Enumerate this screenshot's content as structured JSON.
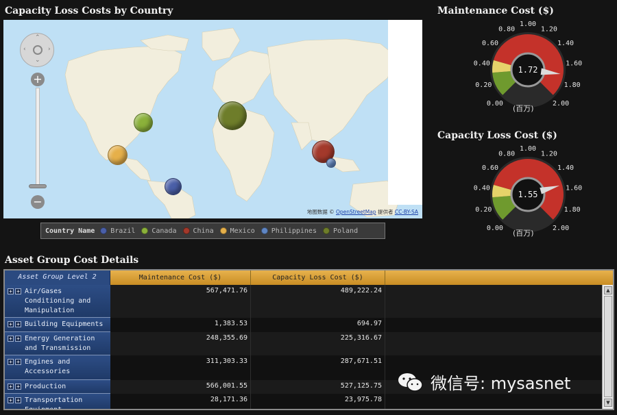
{
  "map_panel": {
    "title": "Capacity Loss Costs by Country",
    "attribution": {
      "prefix": "地图数据 ©",
      "link1": "OpenStreetMap",
      "mid": "提供者",
      "link2": "CC-BY-SA"
    },
    "legend": {
      "title": "Country Name",
      "items": [
        {
          "label": "Brazil",
          "color": "#4a5fa8"
        },
        {
          "label": "Canada",
          "color": "#8bb13a"
        },
        {
          "label": "China",
          "color": "#a3392b"
        },
        {
          "label": "Mexico",
          "color": "#e6b04a"
        },
        {
          "label": "Philippines",
          "color": "#5f86c4"
        },
        {
          "label": "Poland",
          "color": "#6e7d2a"
        }
      ]
    }
  },
  "gauges": [
    {
      "title": "Maintenance Cost ($)",
      "value": 1.72,
      "value_label": "1.72",
      "unit": "(百万)",
      "min": 0,
      "max": 2,
      "ticks": [
        "0.00",
        "0.20",
        "0.40",
        "0.60",
        "0.80",
        "1.00",
        "1.20",
        "1.40",
        "1.60",
        "1.80",
        "2.00"
      ]
    },
    {
      "title": "Capacity Loss Cost ($)",
      "value": 1.55,
      "value_label": "1.55",
      "unit": "(百万)",
      "min": 0,
      "max": 2,
      "ticks": [
        "0.00",
        "0.20",
        "0.40",
        "0.60",
        "0.80",
        "1.00",
        "1.20",
        "1.40",
        "1.60",
        "1.80",
        "2.00"
      ]
    }
  ],
  "table": {
    "title": "Asset Group Cost Details",
    "row_header": "Asset Group Level 2",
    "columns": [
      "Maintenance Cost ($)",
      "Capacity Loss Cost ($)"
    ],
    "rows": [
      {
        "label": "Air/Gases Conditioning and Manipulation",
        "maintenance": "567,471.76",
        "capacity": "489,222.24"
      },
      {
        "label": "Building Equipments",
        "maintenance": "1,383.53",
        "capacity": "694.97"
      },
      {
        "label": "Energy Generation and Transmission",
        "maintenance": "248,355.69",
        "capacity": "225,316.67"
      },
      {
        "label": "Engines and Accessories",
        "maintenance": "311,303.33",
        "capacity": "287,671.51"
      },
      {
        "label": "Production",
        "maintenance": "566,001.55",
        "capacity": "527,125.75"
      },
      {
        "label": "Transportation Equipment",
        "maintenance": "28,171.36",
        "capacity": "23,975.78"
      }
    ]
  },
  "watermark": "微信号: mysasnet"
}
